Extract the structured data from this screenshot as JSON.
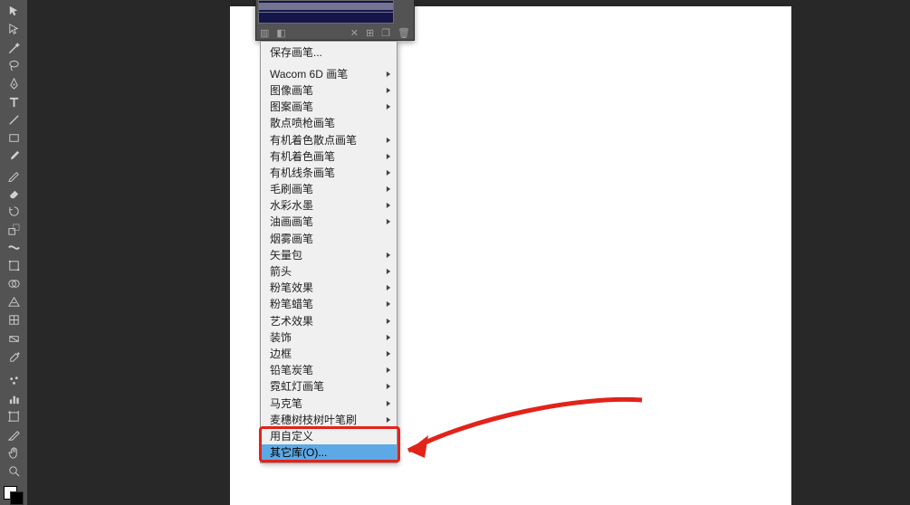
{
  "menu": {
    "save_brush": "保存画笔...",
    "items": [
      {
        "label": "Wacom 6D 画笔",
        "sub": true
      },
      {
        "label": "图像画笔",
        "sub": true
      },
      {
        "label": "图案画笔",
        "sub": true
      },
      {
        "label": "散点喷枪画笔"
      },
      {
        "label": "有机着色散点画笔",
        "sub": true
      },
      {
        "label": "有机着色画笔",
        "sub": true
      },
      {
        "label": "有机线条画笔",
        "sub": true
      },
      {
        "label": "毛刷画笔",
        "sub": true
      },
      {
        "label": "水彩水墨",
        "sub": true
      },
      {
        "label": "油画画笔",
        "sub": true
      },
      {
        "label": "烟雾画笔"
      },
      {
        "label": "矢量包",
        "sub": true
      },
      {
        "label": "箭头",
        "sub": true
      },
      {
        "label": "粉笔效果",
        "sub": true
      },
      {
        "label": "粉笔蜡笔",
        "sub": true
      },
      {
        "label": "艺术效果",
        "sub": true
      },
      {
        "label": "装饰",
        "sub": true
      },
      {
        "label": "边框",
        "sub": true
      },
      {
        "label": "铅笔炭笔",
        "sub": true
      },
      {
        "label": "霓虹灯画笔",
        "sub": true
      },
      {
        "label": "马克笔",
        "sub": true
      },
      {
        "label": "麦穗树枝树叶笔刷",
        "sub": true
      }
    ],
    "user_defined": "用自定义",
    "other_lib": "其它库(O)..."
  },
  "tools": [
    "selection",
    "direct-selection",
    "magic-wand",
    "lasso",
    "pen",
    "type",
    "line-segment",
    "rectangle",
    "paintbrush",
    "pencil",
    "eraser",
    "rotate",
    "scale",
    "width",
    "free-transform",
    "shape-builder",
    "perspective-grid",
    "mesh",
    "gradient",
    "eyedropper",
    "blend",
    "symbol-sprayer",
    "column-graph",
    "artboard",
    "slice",
    "hand",
    "zoom"
  ]
}
